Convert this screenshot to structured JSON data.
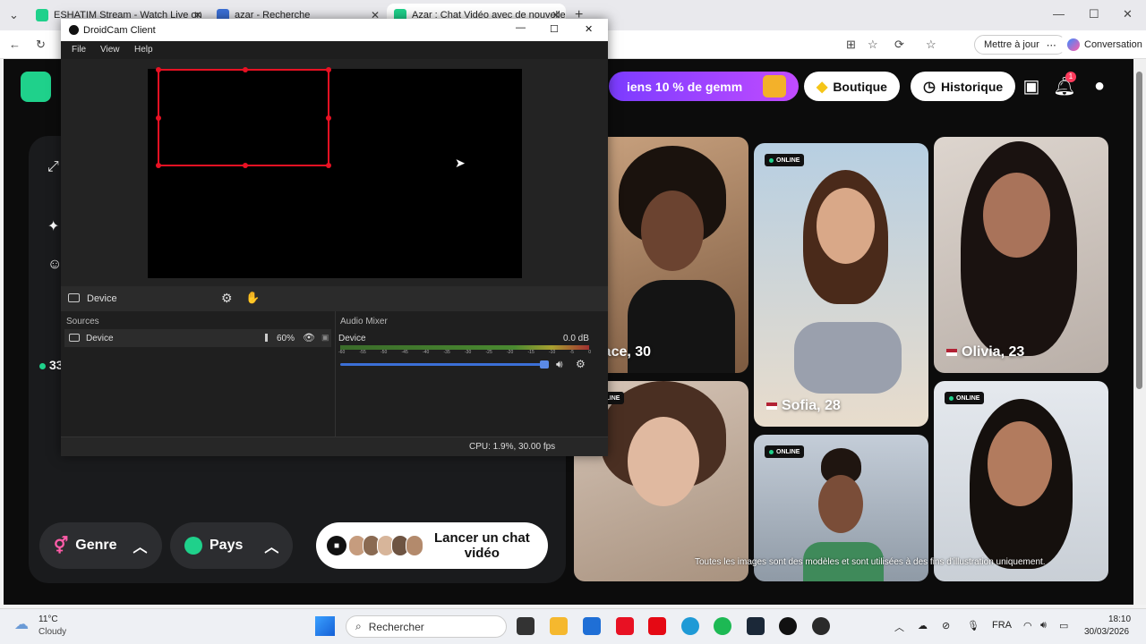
{
  "browser": {
    "tabs": [
      {
        "label": "ESHATIM Stream - Watch Live on",
        "color": "#1fd18b"
      },
      {
        "label": "azar - Recherche",
        "color": "#3b6fd6"
      },
      {
        "label": "Azar : Chat Vidéo avec de nouvelle",
        "color": "#1fd18b",
        "active": true
      }
    ],
    "update_label": "Mettre à jour",
    "conversation_label": "Conversation"
  },
  "header": {
    "promo_text": "iens 10 % de gemm",
    "boutique_label": "Boutique",
    "historique_label": "Historique",
    "notification_count": "1"
  },
  "side_count": "33",
  "cards": [
    {
      "name": "Grace, 30",
      "online": false,
      "skin": "#6b4330",
      "hair": "#1a120d",
      "bg": "#b8906a"
    },
    {
      "name": "Sofia, 28",
      "online": true,
      "flag": true,
      "skin": "#d9a888",
      "hair": "#4a2a1a",
      "bg": "#8fb4cf"
    },
    {
      "name": "Olivia, 23",
      "online": false,
      "flag": true,
      "skin": "#a9735a",
      "hair": "#1a1210",
      "bg": "#d7cfc8"
    },
    {
      "name": "",
      "online": true,
      "skin": "#e0b9a0",
      "hair": "#4a2f22",
      "bg": "#c9b7a8"
    },
    {
      "name": "",
      "online": true,
      "skin": "#7a4d38",
      "hair": "#1f1510",
      "bg": "#a9b7c4"
    },
    {
      "name": "",
      "online": true,
      "skin": "#b27b5e",
      "hair": "#15100d",
      "bg": "#dfe4ea"
    }
  ],
  "online_label": "ONLINE",
  "disclaimer": "Toutes les images sont des modèles et sont utilisées à des fins d'illustration uniquement.",
  "controls": {
    "genre_label": "Genre",
    "pays_label": "Pays",
    "launch_line1": "Lancer un chat",
    "launch_line2": "vidéo"
  },
  "droidcam": {
    "title": "DroidCam Client",
    "menu": [
      "File",
      "View",
      "Help"
    ],
    "source_bar_label": "Device",
    "sources_title": "Sources",
    "source_item": "Device",
    "source_volume": "60%",
    "mixer_title": "Audio Mixer",
    "mixer_device": "Device",
    "mixer_db": "0.0 dB",
    "ticks": [
      "-60",
      "-55",
      "-50",
      "-45",
      "-40",
      "-35",
      "-30",
      "-25",
      "-20",
      "-15",
      "-10",
      "-5",
      "0"
    ],
    "status": "CPU: 1.9%, 30.00 fps"
  },
  "taskbar": {
    "weather_temp": "11°C",
    "weather_desc": "Cloudy",
    "search_placeholder": "Rechercher",
    "lang": "FRA",
    "time": "18:10",
    "date": "30/03/2026"
  }
}
